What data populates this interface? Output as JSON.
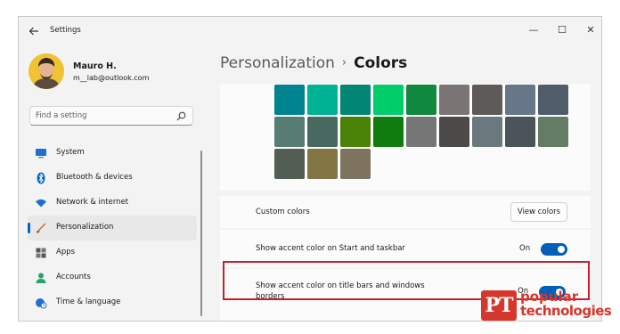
{
  "window": {
    "title": "Settings",
    "back_icon": "arrow-left-icon",
    "controls": {
      "minimize": "—",
      "maximize": "☐",
      "close": "✕"
    }
  },
  "profile": {
    "name": "Mauro H.",
    "email": "m__lab@outlook.com"
  },
  "search": {
    "placeholder": "Find a setting",
    "value": ""
  },
  "sidebar": {
    "items": [
      {
        "label": "System",
        "icon": "monitor-icon",
        "icon_color": "#1f6fd1",
        "active": false
      },
      {
        "label": "Bluetooth & devices",
        "icon": "bluetooth-icon",
        "icon_color": "#0067c0",
        "active": false
      },
      {
        "label": "Network & internet",
        "icon": "wifi-icon",
        "icon_color": "#1f6fd1",
        "active": false
      },
      {
        "label": "Personalization",
        "icon": "brush-icon",
        "icon_color": "#c86b2e",
        "active": true
      },
      {
        "label": "Apps",
        "icon": "apps-icon",
        "icon_color": "#555555",
        "active": false
      },
      {
        "label": "Accounts",
        "icon": "person-icon",
        "icon_color": "#2aa36b",
        "active": false
      },
      {
        "label": "Time & language",
        "icon": "globe-clock-icon",
        "icon_color": "#1f6fd1",
        "active": false
      }
    ]
  },
  "breadcrumb": {
    "parent": "Personalization",
    "separator": "›",
    "current": "Colors"
  },
  "accent_swatches": [
    [
      "#00838f",
      "#00b294",
      "#018574",
      "#00cc6a",
      "#10893e",
      "#7a7574",
      "#5d5a58",
      "#68768a",
      "#515c6b"
    ],
    [
      "#567c73",
      "#486860",
      "#498205",
      "#107c10",
      "#767676",
      "#4c4a48",
      "#69797e",
      "#4a5459",
      "#647c64"
    ],
    [
      "#525e54",
      "#847545",
      "#7e735f"
    ]
  ],
  "custom_colors": {
    "label": "Custom colors",
    "button": "View colors"
  },
  "settings": [
    {
      "label": "Show accent color on Start and taskbar",
      "state": "On",
      "on": true
    },
    {
      "label_line1": "Show accent color on title bars and windows",
      "label_line2": "borders",
      "state": "On",
      "on": true
    }
  ],
  "colors": {
    "accent": "#005fb8",
    "highlight": "#c8202a"
  },
  "watermark": {
    "logo": "PT",
    "line1": "popular",
    "line2": "technologies"
  }
}
